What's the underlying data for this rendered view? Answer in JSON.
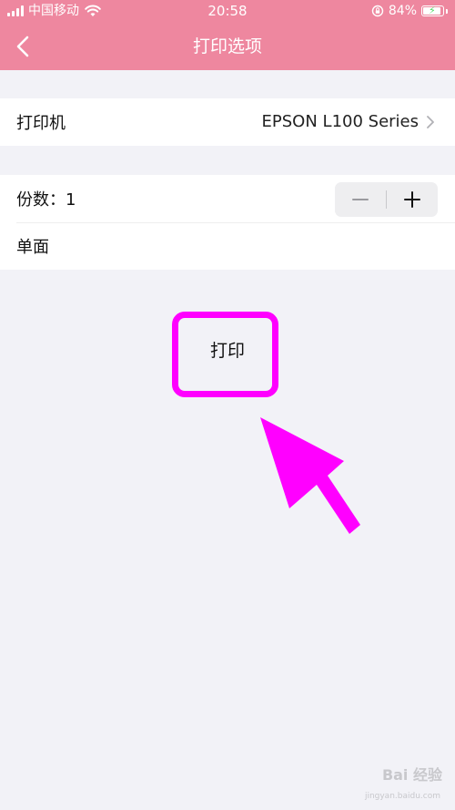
{
  "status_bar": {
    "carrier": "中国移动",
    "time": "20:58",
    "battery_percent": "84%"
  },
  "nav": {
    "title": "打印选项",
    "back_icon": "chevron-left-icon"
  },
  "printer_row": {
    "label": "打印机",
    "value": "EPSON L100 Series",
    "chevron_icon": "chevron-right-icon"
  },
  "copies_row": {
    "label": "份数：1",
    "minus_icon": "minus-icon",
    "plus_icon": "plus-icon"
  },
  "duplex_row": {
    "label": "单面"
  },
  "print_button": {
    "label": "打印"
  },
  "annotation": {
    "highlight_color": "#ff00ff"
  },
  "watermark": {
    "text": "Bai 经验",
    "sub": "jingyan.baidu.com"
  },
  "colors": {
    "header": "#ee879f",
    "background": "#f2f2f7",
    "accent_annotation": "#ff00ff"
  }
}
